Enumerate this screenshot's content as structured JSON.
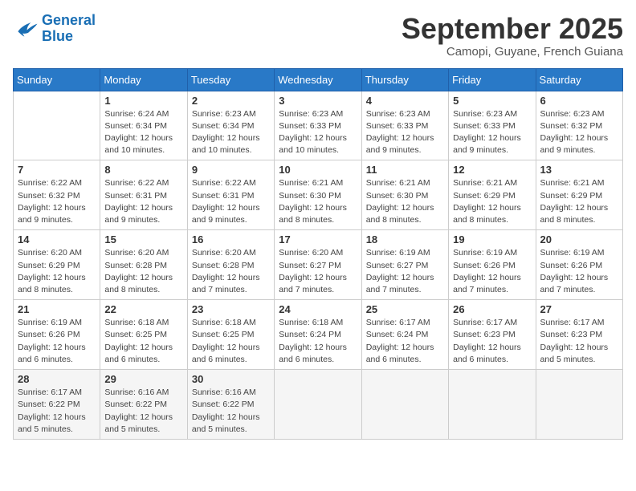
{
  "logo": {
    "line1": "General",
    "line2": "Blue"
  },
  "title": "September 2025",
  "subtitle": "Camopi, Guyane, French Guiana",
  "weekdays": [
    "Sunday",
    "Monday",
    "Tuesday",
    "Wednesday",
    "Thursday",
    "Friday",
    "Saturday"
  ],
  "weeks": [
    [
      {
        "day": null
      },
      {
        "day": "1",
        "info": "Sunrise: 6:24 AM\nSunset: 6:34 PM\nDaylight: 12 hours\nand 10 minutes."
      },
      {
        "day": "2",
        "info": "Sunrise: 6:23 AM\nSunset: 6:34 PM\nDaylight: 12 hours\nand 10 minutes."
      },
      {
        "day": "3",
        "info": "Sunrise: 6:23 AM\nSunset: 6:33 PM\nDaylight: 12 hours\nand 10 minutes."
      },
      {
        "day": "4",
        "info": "Sunrise: 6:23 AM\nSunset: 6:33 PM\nDaylight: 12 hours\nand 9 minutes."
      },
      {
        "day": "5",
        "info": "Sunrise: 6:23 AM\nSunset: 6:33 PM\nDaylight: 12 hours\nand 9 minutes."
      },
      {
        "day": "6",
        "info": "Sunrise: 6:23 AM\nSunset: 6:32 PM\nDaylight: 12 hours\nand 9 minutes."
      }
    ],
    [
      {
        "day": "7",
        "info": "Sunrise: 6:22 AM\nSunset: 6:32 PM\nDaylight: 12 hours\nand 9 minutes."
      },
      {
        "day": "8",
        "info": "Sunrise: 6:22 AM\nSunset: 6:31 PM\nDaylight: 12 hours\nand 9 minutes."
      },
      {
        "day": "9",
        "info": "Sunrise: 6:22 AM\nSunset: 6:31 PM\nDaylight: 12 hours\nand 9 minutes."
      },
      {
        "day": "10",
        "info": "Sunrise: 6:21 AM\nSunset: 6:30 PM\nDaylight: 12 hours\nand 8 minutes."
      },
      {
        "day": "11",
        "info": "Sunrise: 6:21 AM\nSunset: 6:30 PM\nDaylight: 12 hours\nand 8 minutes."
      },
      {
        "day": "12",
        "info": "Sunrise: 6:21 AM\nSunset: 6:29 PM\nDaylight: 12 hours\nand 8 minutes."
      },
      {
        "day": "13",
        "info": "Sunrise: 6:21 AM\nSunset: 6:29 PM\nDaylight: 12 hours\nand 8 minutes."
      }
    ],
    [
      {
        "day": "14",
        "info": "Sunrise: 6:20 AM\nSunset: 6:29 PM\nDaylight: 12 hours\nand 8 minutes."
      },
      {
        "day": "15",
        "info": "Sunrise: 6:20 AM\nSunset: 6:28 PM\nDaylight: 12 hours\nand 8 minutes."
      },
      {
        "day": "16",
        "info": "Sunrise: 6:20 AM\nSunset: 6:28 PM\nDaylight: 12 hours\nand 7 minutes."
      },
      {
        "day": "17",
        "info": "Sunrise: 6:20 AM\nSunset: 6:27 PM\nDaylight: 12 hours\nand 7 minutes."
      },
      {
        "day": "18",
        "info": "Sunrise: 6:19 AM\nSunset: 6:27 PM\nDaylight: 12 hours\nand 7 minutes."
      },
      {
        "day": "19",
        "info": "Sunrise: 6:19 AM\nSunset: 6:26 PM\nDaylight: 12 hours\nand 7 minutes."
      },
      {
        "day": "20",
        "info": "Sunrise: 6:19 AM\nSunset: 6:26 PM\nDaylight: 12 hours\nand 7 minutes."
      }
    ],
    [
      {
        "day": "21",
        "info": "Sunrise: 6:19 AM\nSunset: 6:26 PM\nDaylight: 12 hours\nand 6 minutes."
      },
      {
        "day": "22",
        "info": "Sunrise: 6:18 AM\nSunset: 6:25 PM\nDaylight: 12 hours\nand 6 minutes."
      },
      {
        "day": "23",
        "info": "Sunrise: 6:18 AM\nSunset: 6:25 PM\nDaylight: 12 hours\nand 6 minutes."
      },
      {
        "day": "24",
        "info": "Sunrise: 6:18 AM\nSunset: 6:24 PM\nDaylight: 12 hours\nand 6 minutes."
      },
      {
        "day": "25",
        "info": "Sunrise: 6:17 AM\nSunset: 6:24 PM\nDaylight: 12 hours\nand 6 minutes."
      },
      {
        "day": "26",
        "info": "Sunrise: 6:17 AM\nSunset: 6:23 PM\nDaylight: 12 hours\nand 6 minutes."
      },
      {
        "day": "27",
        "info": "Sunrise: 6:17 AM\nSunset: 6:23 PM\nDaylight: 12 hours\nand 5 minutes."
      }
    ],
    [
      {
        "day": "28",
        "info": "Sunrise: 6:17 AM\nSunset: 6:22 PM\nDaylight: 12 hours\nand 5 minutes."
      },
      {
        "day": "29",
        "info": "Sunrise: 6:16 AM\nSunset: 6:22 PM\nDaylight: 12 hours\nand 5 minutes."
      },
      {
        "day": "30",
        "info": "Sunrise: 6:16 AM\nSunset: 6:22 PM\nDaylight: 12 hours\nand 5 minutes."
      },
      {
        "day": null
      },
      {
        "day": null
      },
      {
        "day": null
      },
      {
        "day": null
      }
    ]
  ]
}
